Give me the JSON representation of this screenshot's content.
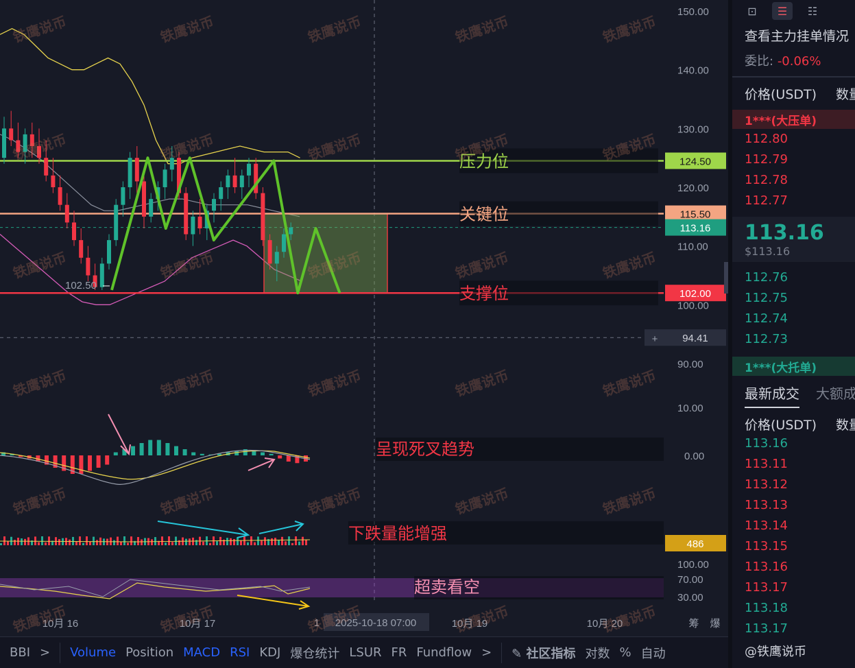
{
  "chart_data": {
    "type": "candlestick",
    "price_axis": {
      "ticks": [
        "150.00",
        "140.00",
        "130.00",
        "120.00",
        "110.00",
        "100.00",
        "90.00"
      ],
      "range": [
        88,
        152
      ]
    },
    "x_axis": {
      "ticks": [
        "10月 16",
        "10月 17",
        "10月 19",
        "10月 20"
      ],
      "crosshair_label": "2025-10-18 07:00",
      "trailing_labels": [
        "1",
        "筹",
        "爆"
      ]
    },
    "price_tags": [
      {
        "value": "124.50",
        "color": "#9fd64a",
        "text_color": "#1a1a1a"
      },
      {
        "value": "115.50",
        "color": "#f4a582",
        "text_color": "#1a1a1a"
      },
      {
        "value": "113.16",
        "color": "#1f9e80",
        "text_color": "#ffffff"
      },
      {
        "value": "102.00",
        "color": "#f23645",
        "text_color": "#ffffff"
      },
      {
        "value": "94.41",
        "color": "#2a2e3d",
        "text_color": "#d1d4dc"
      }
    ],
    "horizontal_levels": [
      {
        "name": "压力位",
        "price": 124.5,
        "color": "#9fd64a"
      },
      {
        "name": "关键位",
        "price": 115.5,
        "color": "#f4a582"
      },
      {
        "name": "支撑位",
        "price": 102.0,
        "color": "#f23645"
      }
    ],
    "low_label": "102.50",
    "candles": [
      [
        125,
        132,
        124,
        130
      ],
      [
        130,
        133,
        127,
        128
      ],
      [
        128,
        131,
        125,
        126
      ],
      [
        126,
        130,
        124,
        129
      ],
      [
        129,
        131,
        125,
        127
      ],
      [
        127,
        130,
        124,
        125
      ],
      [
        125,
        128,
        121,
        122
      ],
      [
        122,
        125,
        119,
        120
      ],
      [
        120,
        122,
        116,
        117
      ],
      [
        117,
        119,
        113,
        114
      ],
      [
        114,
        116,
        110,
        111
      ],
      [
        111,
        113,
        107,
        108
      ],
      [
        108,
        110,
        104,
        105
      ],
      [
        105,
        107,
        102.5,
        103
      ],
      [
        103,
        108,
        102.5,
        107
      ],
      [
        107,
        112,
        106,
        111
      ],
      [
        111,
        118,
        110,
        117
      ],
      [
        117,
        121,
        115,
        120
      ],
      [
        120,
        126,
        118,
        125
      ],
      [
        125,
        127,
        119,
        121
      ],
      [
        121,
        122,
        113,
        115
      ],
      [
        115,
        119,
        114,
        118
      ],
      [
        118,
        121,
        116,
        120
      ],
      [
        120,
        124,
        118,
        123
      ],
      [
        123,
        127,
        121,
        125
      ],
      [
        125,
        126,
        118,
        119
      ],
      [
        119,
        120,
        111,
        112
      ],
      [
        112,
        116,
        110,
        115
      ],
      [
        115,
        118,
        112,
        113
      ],
      [
        113,
        117,
        111,
        116
      ],
      [
        116,
        119,
        114,
        118
      ],
      [
        118,
        121,
        116,
        120
      ],
      [
        120,
        123,
        118,
        122
      ],
      [
        122,
        125,
        119,
        120
      ],
      [
        120,
        123,
        118,
        122
      ],
      [
        122,
        125,
        120,
        124
      ],
      [
        124,
        125,
        118,
        119
      ],
      [
        119,
        120,
        110,
        111
      ],
      [
        111,
        112,
        106,
        107
      ],
      [
        107,
        110,
        104,
        109
      ],
      [
        109,
        113,
        108,
        112
      ],
      [
        112,
        114,
        111,
        113.16
      ]
    ],
    "zigzag_points": [
      [
        0,
        102.5
      ],
      [
        6,
        125
      ],
      [
        9,
        113
      ],
      [
        13,
        125
      ],
      [
        17,
        111
      ],
      [
        27,
        124.5
      ],
      [
        31,
        102
      ],
      [
        34,
        113
      ],
      [
        38,
        102
      ]
    ],
    "bollinger": {
      "upper": [
        146,
        147,
        146,
        144,
        142,
        141,
        140,
        140,
        141,
        142,
        141,
        138,
        134,
        128,
        124,
        124,
        125,
        125.5,
        126,
        126.5,
        127,
        126.5,
        126,
        126,
        126,
        125
      ],
      "middle": [
        129,
        128,
        126.5,
        125,
        123,
        121,
        119,
        117,
        116,
        116,
        116.5,
        117,
        117.5,
        118,
        118,
        117.5,
        117,
        117,
        117,
        117,
        116.5,
        116,
        115.5,
        115
      ],
      "lower": [
        112,
        110,
        108,
        106,
        104,
        102,
        100.5,
        100,
        100,
        101,
        102,
        103,
        104,
        106,
        108,
        109,
        110,
        111,
        110,
        108,
        106,
        105,
        104
      ]
    },
    "box": {
      "top": 115.5,
      "bottom": 102.0
    },
    "macd": {
      "axis_ticks": [
        "10.00",
        "0.00"
      ],
      "histogram": [
        1,
        0.5,
        -0.5,
        -1,
        -2,
        -3,
        -4,
        -5,
        -6,
        -6,
        -5,
        -4,
        -3,
        1,
        2,
        3,
        4,
        5,
        5,
        4,
        3,
        2,
        1,
        0.5,
        0.3,
        0.5,
        1,
        1.5,
        2,
        1.5,
        1,
        0.5,
        -1,
        -2,
        -2.5,
        -2
      ],
      "annotation": "呈现死叉趋势"
    },
    "volume": {
      "last_tag": "486",
      "annotation": "下跌量能增强"
    },
    "rsi": {
      "axis_ticks": [
        "100.00",
        "70.00",
        "30.00"
      ],
      "annotation": "超卖看空"
    },
    "annotations": [
      "压力位",
      "关键位",
      "支撑位"
    ]
  },
  "watermark": "铁鹰说币",
  "bottom_bar": {
    "items": [
      {
        "label": "BBI",
        "active": false
      },
      {
        "label": ">",
        "active": false
      },
      {
        "label": "Volume",
        "active": true
      },
      {
        "label": "Position",
        "active": false
      },
      {
        "label": "MACD",
        "active": true
      },
      {
        "label": "RSI",
        "active": true
      },
      {
        "label": "KDJ",
        "active": false
      },
      {
        "label": "爆仓统计",
        "active": false
      },
      {
        "label": "LSUR",
        "active": false
      },
      {
        "label": "FR",
        "active": false
      },
      {
        "label": "Fundflow",
        "active": false
      },
      {
        "label": ">",
        "active": false
      }
    ],
    "community": "社区指标",
    "log_label": "对数",
    "percent_label": "%",
    "auto_label": "自动"
  },
  "right_panel": {
    "title": "查看主力挂单情况",
    "ratio_label": "委比:",
    "ratio_value": "-0.06%",
    "col_price": "价格(USDT)",
    "col_qty": "数量",
    "ask_badge": "1***(大压单)",
    "asks": [
      "112.80",
      "112.79",
      "112.78",
      "112.77"
    ],
    "mid_price": "113.16",
    "mid_usd": "$113.16",
    "bids": [
      "112.76",
      "112.75",
      "112.74",
      "112.73"
    ],
    "bid_badge": "1***(大托单)",
    "tab_latest": "最新成交",
    "tab_large": "大额成交",
    "trades_col_price": "价格(USDT)",
    "trades_col_qty": "数量",
    "trades": [
      {
        "p": "113.16",
        "c": "green"
      },
      {
        "p": "113.11",
        "c": "red"
      },
      {
        "p": "113.12",
        "c": "red"
      },
      {
        "p": "113.13",
        "c": "red"
      },
      {
        "p": "113.14",
        "c": "red"
      },
      {
        "p": "113.15",
        "c": "red"
      },
      {
        "p": "113.16",
        "c": "red"
      },
      {
        "p": "113.17",
        "c": "red"
      },
      {
        "p": "113.18",
        "c": "green"
      },
      {
        "p": "113.17",
        "c": "green"
      }
    ],
    "footer": "@铁鹰说币"
  }
}
